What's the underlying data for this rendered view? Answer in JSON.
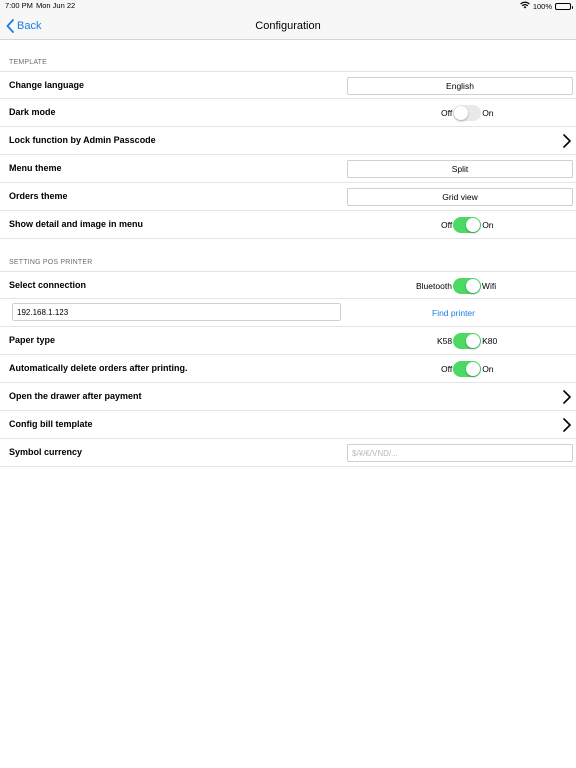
{
  "status_bar": {
    "time": "7:00 PM",
    "date": "Mon Jun 22",
    "battery": "100%"
  },
  "nav": {
    "back_label": "Back",
    "title": "Configuration"
  },
  "template_section": {
    "header": "TEMPLATE",
    "change_language": {
      "label": "Change language",
      "value": "English"
    },
    "dark_mode": {
      "label": "Dark mode",
      "off_label": "Off",
      "on_label": "On",
      "enabled": false
    },
    "lock_function": {
      "label": "Lock function by Admin Passcode"
    },
    "menu_theme": {
      "label": "Menu theme",
      "value": "Split"
    },
    "orders_theme": {
      "label": "Orders theme",
      "value": "Grid view"
    },
    "show_detail": {
      "label": "Show detail and image in menu",
      "off_label": "Off",
      "on_label": "On",
      "enabled": true
    }
  },
  "printer_section": {
    "header": "SETTING POS PRINTER",
    "select_connection": {
      "label": "Select connection",
      "left_label": "Bluetooth",
      "right_label": "Wifi",
      "enabled": true
    },
    "ip_address": {
      "value": "192.168.1.123",
      "find_printer_label": "Find printer"
    },
    "paper_type": {
      "label": "Paper type",
      "left_label": "K58",
      "right_label": "K80",
      "enabled": true
    },
    "auto_delete": {
      "label": "Automatically delete orders after printing.",
      "off_label": "Off",
      "on_label": "On",
      "enabled": true
    },
    "open_drawer": {
      "label": "Open the drawer after payment"
    },
    "config_bill": {
      "label": "Config bill template"
    },
    "symbol_currency": {
      "label": "Symbol currency",
      "placeholder": "$/¥/€/VND/..."
    }
  },
  "colors": {
    "accent": "#1a7ee6",
    "toggle_on": "#4cd964",
    "toggle_off": "#e9e9ea"
  }
}
